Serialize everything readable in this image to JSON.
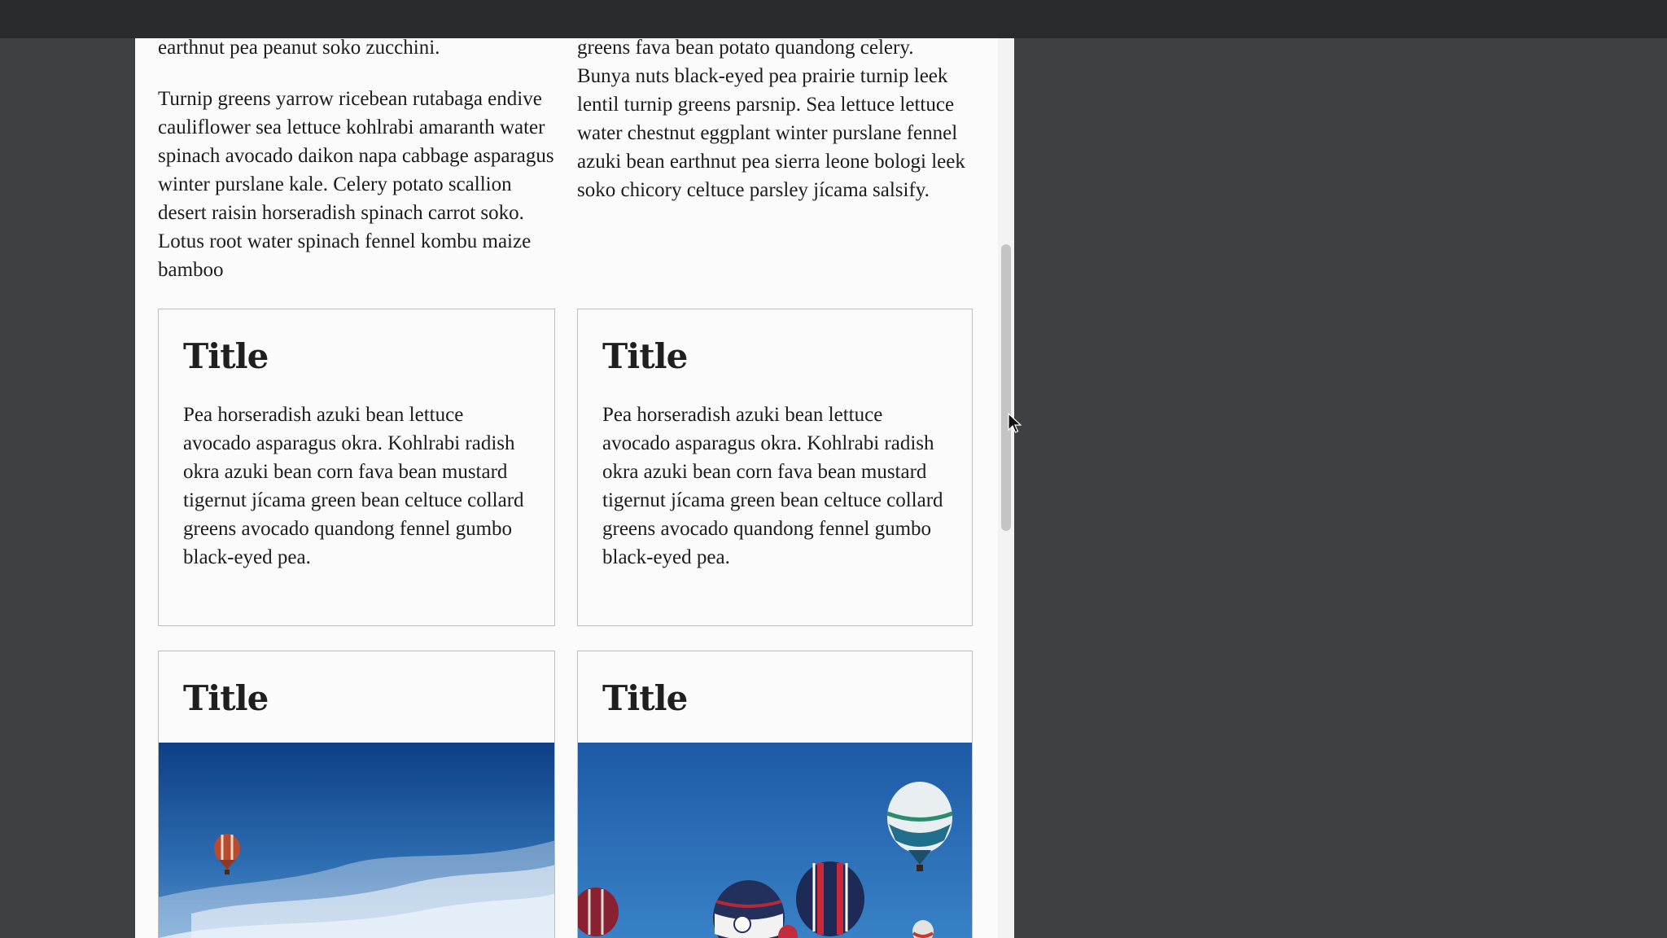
{
  "left_column": {
    "paragraph_1": "earthnut pea peanut soko zucchini.",
    "paragraph_2": "Turnip greens yarrow ricebean rutabaga endive cauliflower sea lettuce kohlrabi amaranth water spinach avocado daikon napa cabbage asparagus winter purslane kale. Celery potato scallion desert raisin horseradish spinach carrot soko. Lotus root water spinach fennel kombu maize bamboo"
  },
  "right_column": {
    "paragraph_1": "greens fava bean potato quandong celery. Bunya nuts black-eyed pea prairie turnip leek lentil turnip greens parsnip. Sea lettuce lettuce water chestnut eggplant winter purslane fennel azuki bean earthnut pea sierra leone bologi leek soko chicory celtuce parsley jícama salsify."
  },
  "cards": [
    {
      "title": "Title",
      "body": "Pea horseradish azuki bean lettuce avocado asparagus okra. Kohlrabi radish okra azuki bean corn fava bean mustard tigernut jícama green bean celtuce collard greens avocado quandong fennel gumbo black-eyed pea."
    },
    {
      "title": "Title",
      "body": "Pea horseradish azuki bean lettuce avocado asparagus okra. Kohlrabi radish okra azuki bean corn fava bean mustard tigernut jícama green bean celtuce collard greens avocado quandong fennel gumbo black-eyed pea."
    },
    {
      "title": "Title",
      "image": "hot-air-balloon-photo"
    },
    {
      "title": "Title",
      "image": "hot-air-balloons-photo"
    }
  ],
  "colors": {
    "page_background": "#fcfbfc",
    "outer_background": "#3f4043",
    "topbar": "#2a2b2e",
    "sky": "#2f6fb3"
  }
}
